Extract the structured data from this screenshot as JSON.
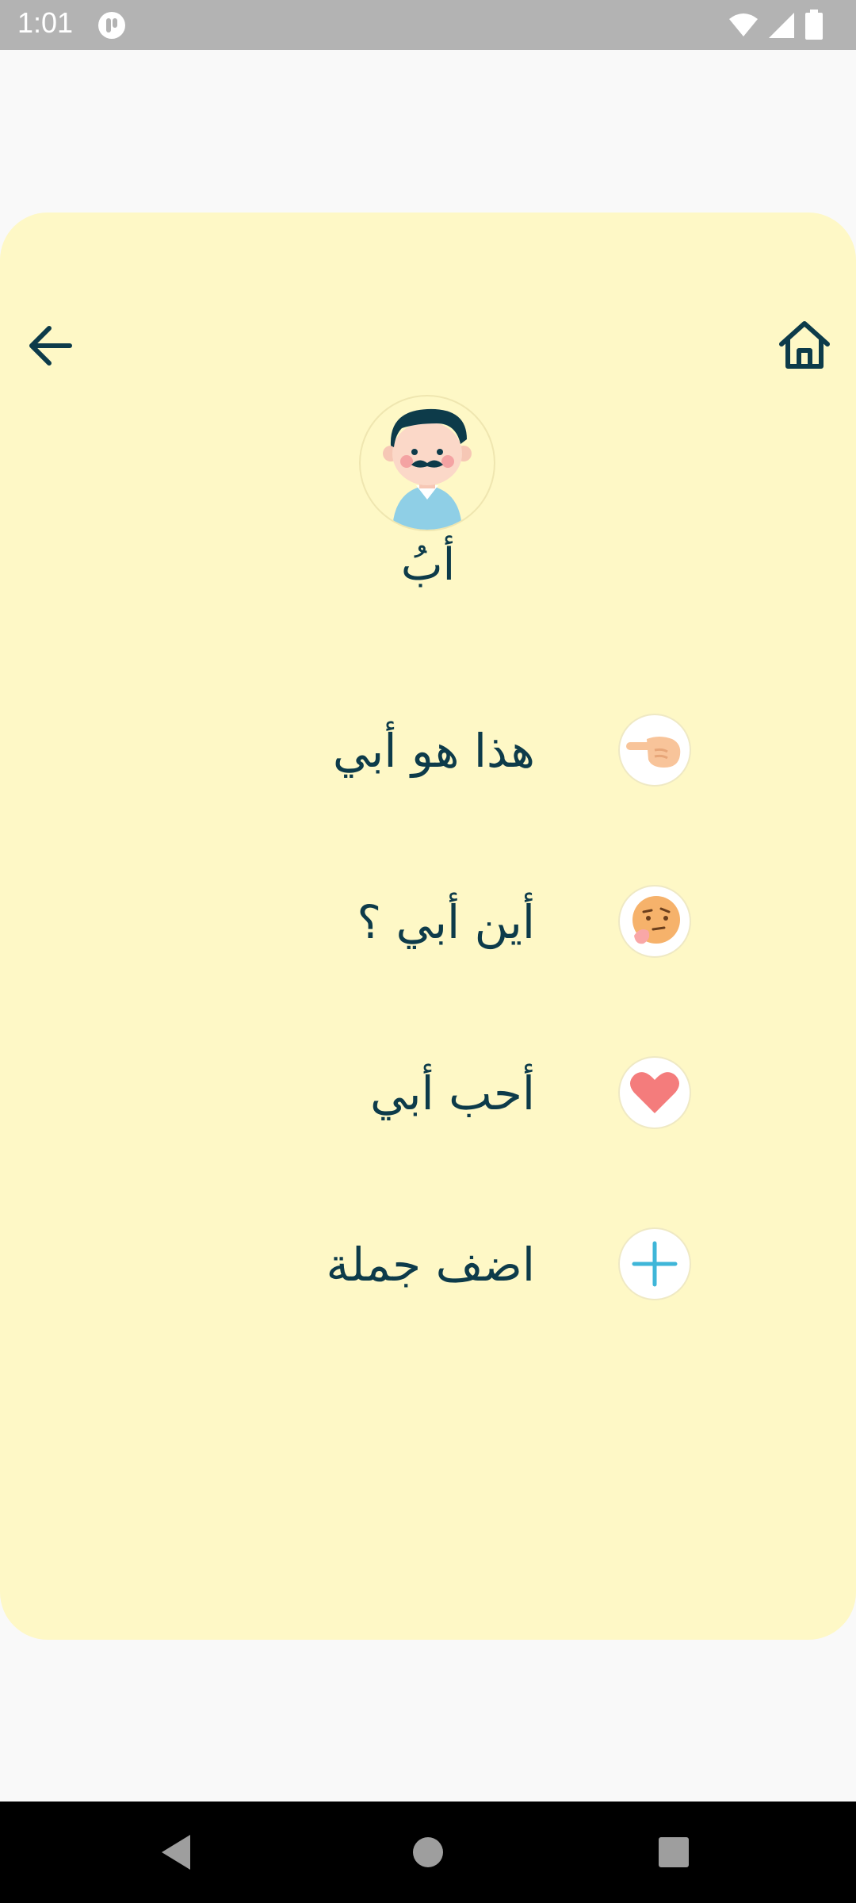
{
  "status_bar": {
    "time": "1:01",
    "icons": [
      "app-notification-icon",
      "wifi-icon",
      "signal-icon",
      "battery-icon"
    ]
  },
  "header": {
    "back_icon": "arrow-left-icon",
    "home_icon": "home-icon"
  },
  "profile": {
    "avatar_icon": "father-avatar-icon",
    "label": "أبُ"
  },
  "phrases": [
    {
      "icon": "pointing-hand-icon",
      "text": "هذا هو أبي"
    },
    {
      "icon": "thinking-face-icon",
      "text": "أين أبي ؟"
    },
    {
      "icon": "heart-icon",
      "text": "أحب أبي"
    },
    {
      "icon": "plus-icon",
      "text": "اضف جملة"
    }
  ],
  "navigation": {
    "back": "nav-back-icon",
    "home": "nav-home-icon",
    "recents": "nav-recents-icon"
  },
  "colors": {
    "card_background": "#fef8c6",
    "text": "#0d3b4a",
    "accent_blue": "#3fb6d8",
    "heart": "#f47c7c"
  }
}
